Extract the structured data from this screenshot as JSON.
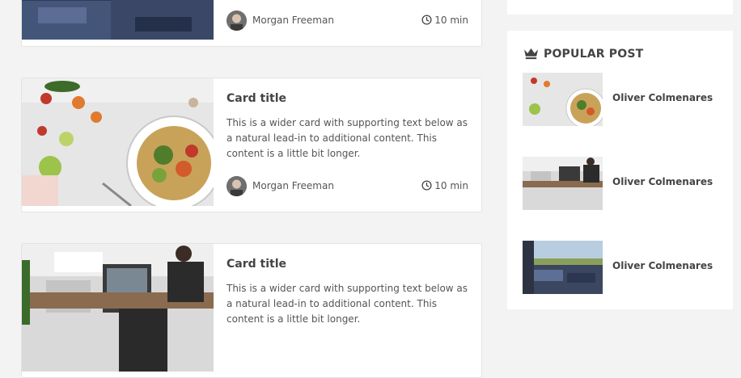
{
  "cards": [
    {
      "author": "Morgan Freeman",
      "read_time": "10 min",
      "image": "legs-on-jeans-photo"
    },
    {
      "title": "Card title",
      "text": "This is a wider card with supporting text below as a natural lead-in to additional content. This content is a little bit longer.",
      "author": "Morgan Freeman",
      "read_time": "10 min",
      "image": "food-bowl-photo"
    },
    {
      "title": "Card title",
      "text": "This is a wider card with supporting text below as a natural lead-in to additional content. This content is a little bit longer.",
      "image": "office-photo"
    }
  ],
  "sidebar": {
    "popular_heading": "POPULAR POST",
    "heading_icon": "crown-icon",
    "items": [
      {
        "name": "Oliver Colmenares",
        "image": "food-bowl-photo"
      },
      {
        "name": "Oliver Colmenares",
        "image": "office-photo"
      },
      {
        "name": "Oliver Colmenares",
        "image": "landscape-feet-photo"
      }
    ]
  },
  "colors": {
    "background": "#f3f3f3",
    "card": "#ffffff",
    "text": "#444444"
  }
}
